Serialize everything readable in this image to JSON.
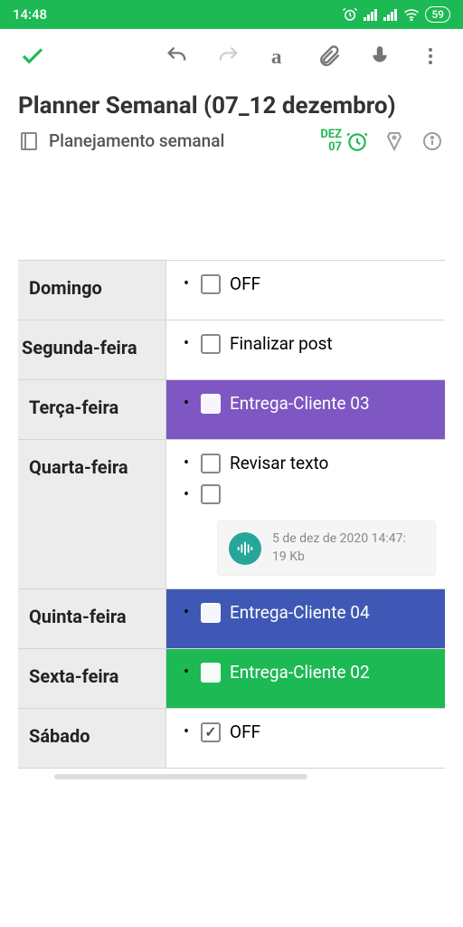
{
  "status": {
    "time": "14:48",
    "battery": "59"
  },
  "title": "Planner Semanal (07_12 dezembro)",
  "notebook": "Planejamento semanal",
  "reminder": {
    "month": "DEZ",
    "day": "07"
  },
  "days": {
    "sun": {
      "label": "Domingo",
      "task": "OFF"
    },
    "mon": {
      "label": "Segunda-feira",
      "task": "Finalizar post"
    },
    "tue": {
      "label": "Terça-feira",
      "task": "Entrega-Cliente 03"
    },
    "wed": {
      "label": "Quarta-feira",
      "task1": "Revisar texto",
      "audio_date": "5 de dez de 2020 14:47:",
      "audio_size": "19 Kb"
    },
    "thu": {
      "label": "Quinta-feira",
      "task": "Entrega-Cliente 04"
    },
    "fri": {
      "label": "Sexta-feira",
      "task": "Entrega-Cliente 02"
    },
    "sat": {
      "label": "Sábado",
      "task": "OFF"
    }
  }
}
